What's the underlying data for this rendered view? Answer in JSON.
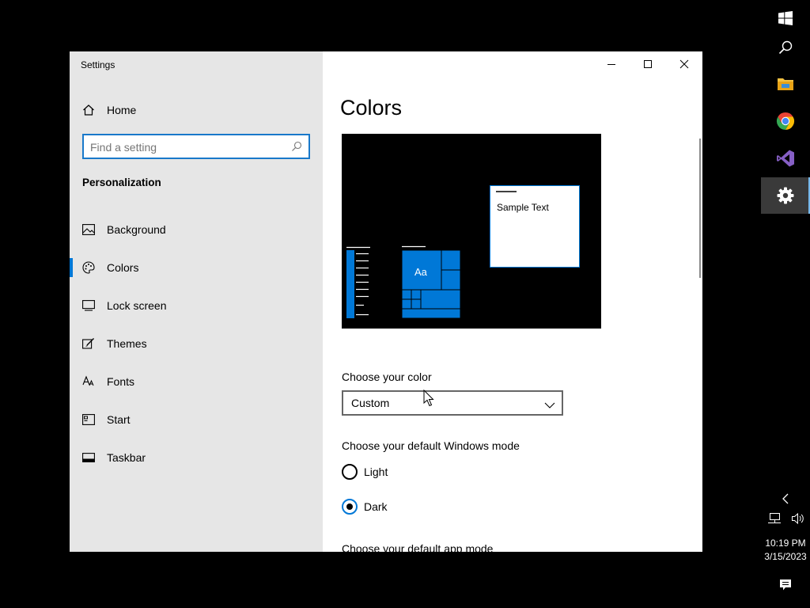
{
  "window": {
    "title": "Settings",
    "controls": [
      "minimize",
      "maximize",
      "close"
    ]
  },
  "sidebar": {
    "home_label": "Home",
    "search": {
      "placeholder": "Find a setting",
      "value": ""
    },
    "section_title": "Personalization",
    "items": [
      {
        "label": "Background",
        "icon": "picture-icon",
        "active": false
      },
      {
        "label": "Colors",
        "icon": "palette-icon",
        "active": true
      },
      {
        "label": "Lock screen",
        "icon": "lock-screen-icon",
        "active": false
      },
      {
        "label": "Themes",
        "icon": "brush-icon",
        "active": false
      },
      {
        "label": "Fonts",
        "icon": "fonts-icon",
        "active": false
      },
      {
        "label": "Start",
        "icon": "start-icon",
        "active": false
      },
      {
        "label": "Taskbar",
        "icon": "taskbar-icon",
        "active": false
      }
    ]
  },
  "main": {
    "title": "Colors",
    "preview": {
      "tile_text": "Aa",
      "sample_text": "Sample Text",
      "accent_color": "#0078d7"
    },
    "choose_color_label": "Choose your color",
    "choose_color_value": "Custom",
    "windows_mode_label": "Choose your default Windows mode",
    "windows_mode_options": [
      {
        "label": "Light",
        "selected": false
      },
      {
        "label": "Dark",
        "selected": true
      }
    ],
    "app_mode_label": "Choose your default app mode"
  },
  "taskbar": {
    "apps": [
      "windows-start-icon",
      "search-icon",
      "file-explorer-icon",
      "chrome-icon",
      "visual-studio-icon",
      "settings-icon"
    ],
    "active_app": "settings-icon",
    "time": "10:19 PM",
    "date": "3/15/2023"
  }
}
